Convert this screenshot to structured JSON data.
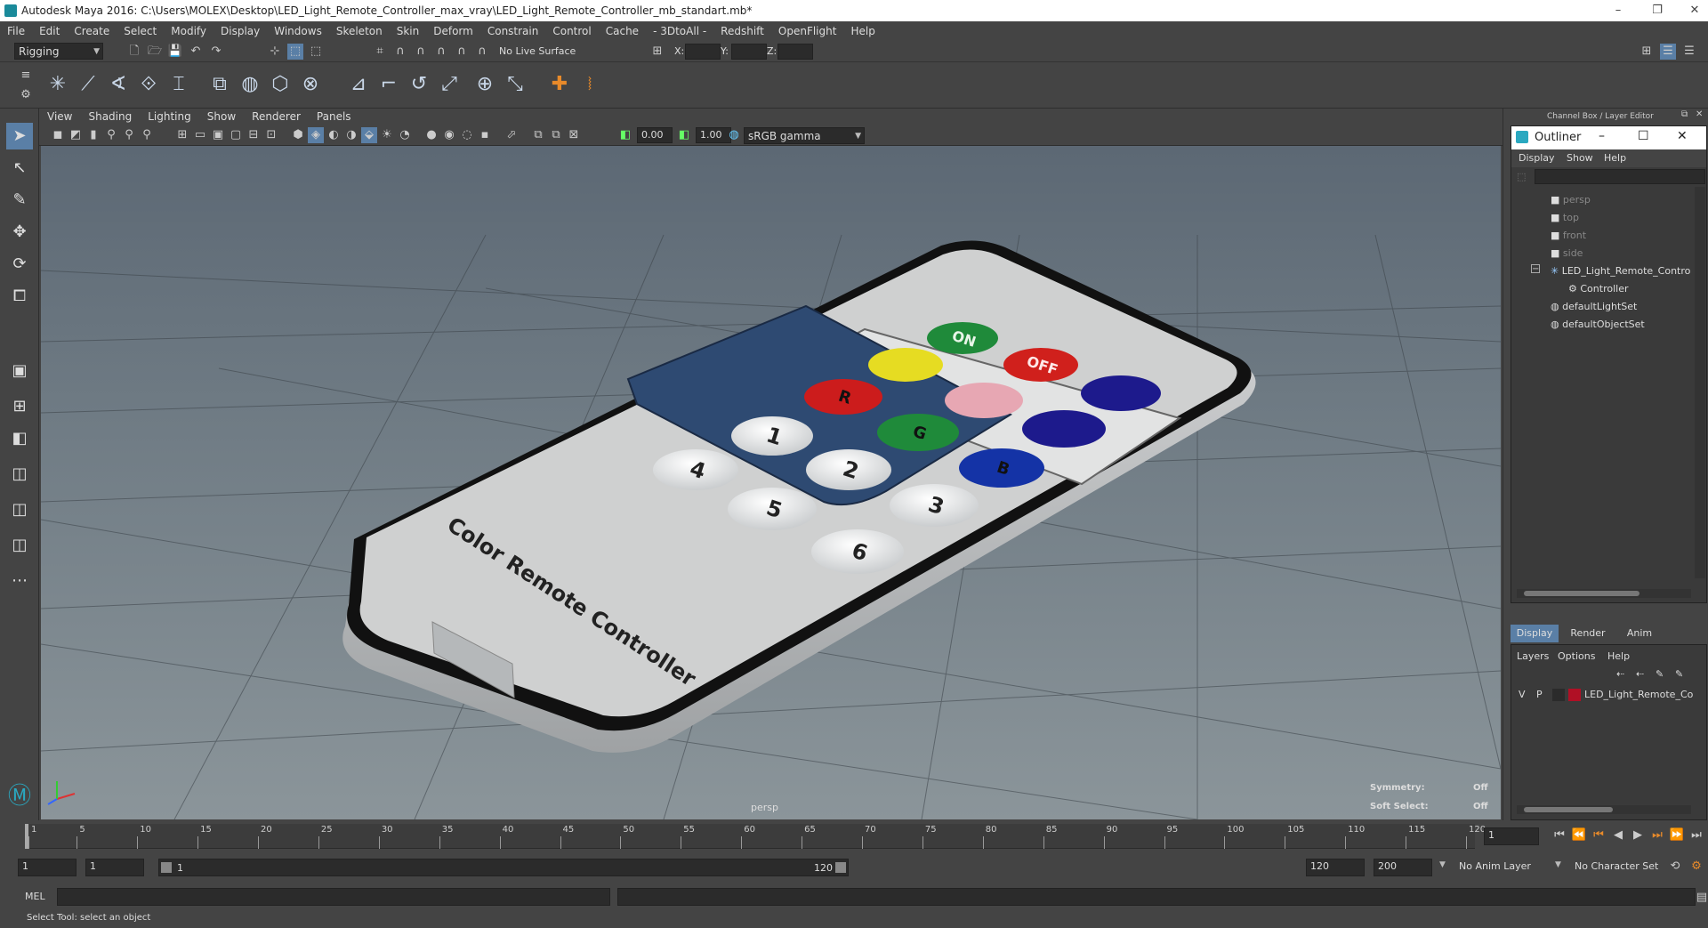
{
  "window": {
    "title": "Autodesk Maya 2016: C:\\Users\\MOLEX\\Desktop\\LED_Light_Remote_Controller_max_vray\\LED_Light_Remote_Controller_mb_standart.mb*",
    "minimize": "–",
    "restore": "❐",
    "close": "✕"
  },
  "menubar": [
    "File",
    "Edit",
    "Create",
    "Select",
    "Modify",
    "Display",
    "Windows",
    "Skeleton",
    "Skin",
    "Deform",
    "Constrain",
    "Control",
    "Cache",
    "- 3DtoAll -",
    "Redshift",
    "OpenFlight",
    "Help"
  ],
  "statusline": {
    "mode": "Rigging",
    "live_surface": "No Live Surface",
    "x_label": "X:",
    "y_label": "Y:",
    "z_label": "Z:"
  },
  "viewport": {
    "menu": [
      "View",
      "Shading",
      "Lighting",
      "Show",
      "Renderer",
      "Panels"
    ],
    "field_a": "0.00",
    "field_b": "1.00",
    "color_mode": "sRGB gamma",
    "camera_label": "persp",
    "symmetry_label": "Symmetry:",
    "symmetry_value": "Off",
    "soft_select_label": "Soft Select:",
    "soft_select_value": "Off"
  },
  "model": {
    "caption": "Color Remote Controller",
    "on": "ON",
    "off": "OFF",
    "r": "R",
    "g": "G",
    "b": "B",
    "nums": [
      "1",
      "2",
      "3",
      "4",
      "5",
      "6"
    ],
    "colors": {
      "on": "#1f8a3a",
      "off": "#d0201c",
      "yellow": "#e6dc22",
      "red": "#cc1c1c",
      "pink": "#e7a7b3",
      "green": "#1f8a3a",
      "blue": "#1433a6",
      "navy": "#1d1a8c",
      "body": "#cfd0d0",
      "panel": "#2e4a72"
    }
  },
  "channel_box_title": "Channel Box / Layer Editor",
  "outliner": {
    "title": "Outliner",
    "menu": [
      "Display",
      "Show",
      "Help"
    ],
    "items": [
      "persp",
      "top",
      "front",
      "side",
      "LED_Light_Remote_Contro",
      "Controller",
      "defaultLightSet",
      "defaultObjectSet"
    ]
  },
  "layer_editor": {
    "tabs": [
      "Display",
      "Render",
      "Anim"
    ],
    "menu": [
      "Layers",
      "Options",
      "Help"
    ],
    "v": "V",
    "p": "P",
    "layer_name": "LED_Light_Remote_Co",
    "layer_color": "#b01025"
  },
  "timeline": {
    "ticks": [
      "1",
      "5",
      "10",
      "15",
      "20",
      "25",
      "30",
      "35",
      "40",
      "45",
      "50",
      "55",
      "60",
      "65",
      "70",
      "75",
      "80",
      "85",
      "90",
      "95",
      "100",
      "105",
      "110",
      "115",
      "120"
    ],
    "current_frame": "1"
  },
  "range": {
    "start": "1",
    "playback_start": "1",
    "slider_start": "1",
    "slider_end": "120",
    "playback_end": "120",
    "end": "200",
    "anim_layer": "No Anim Layer",
    "character_set": "No Character Set"
  },
  "cmd": {
    "label": "MEL"
  },
  "help_line": "Select Tool: select an object"
}
